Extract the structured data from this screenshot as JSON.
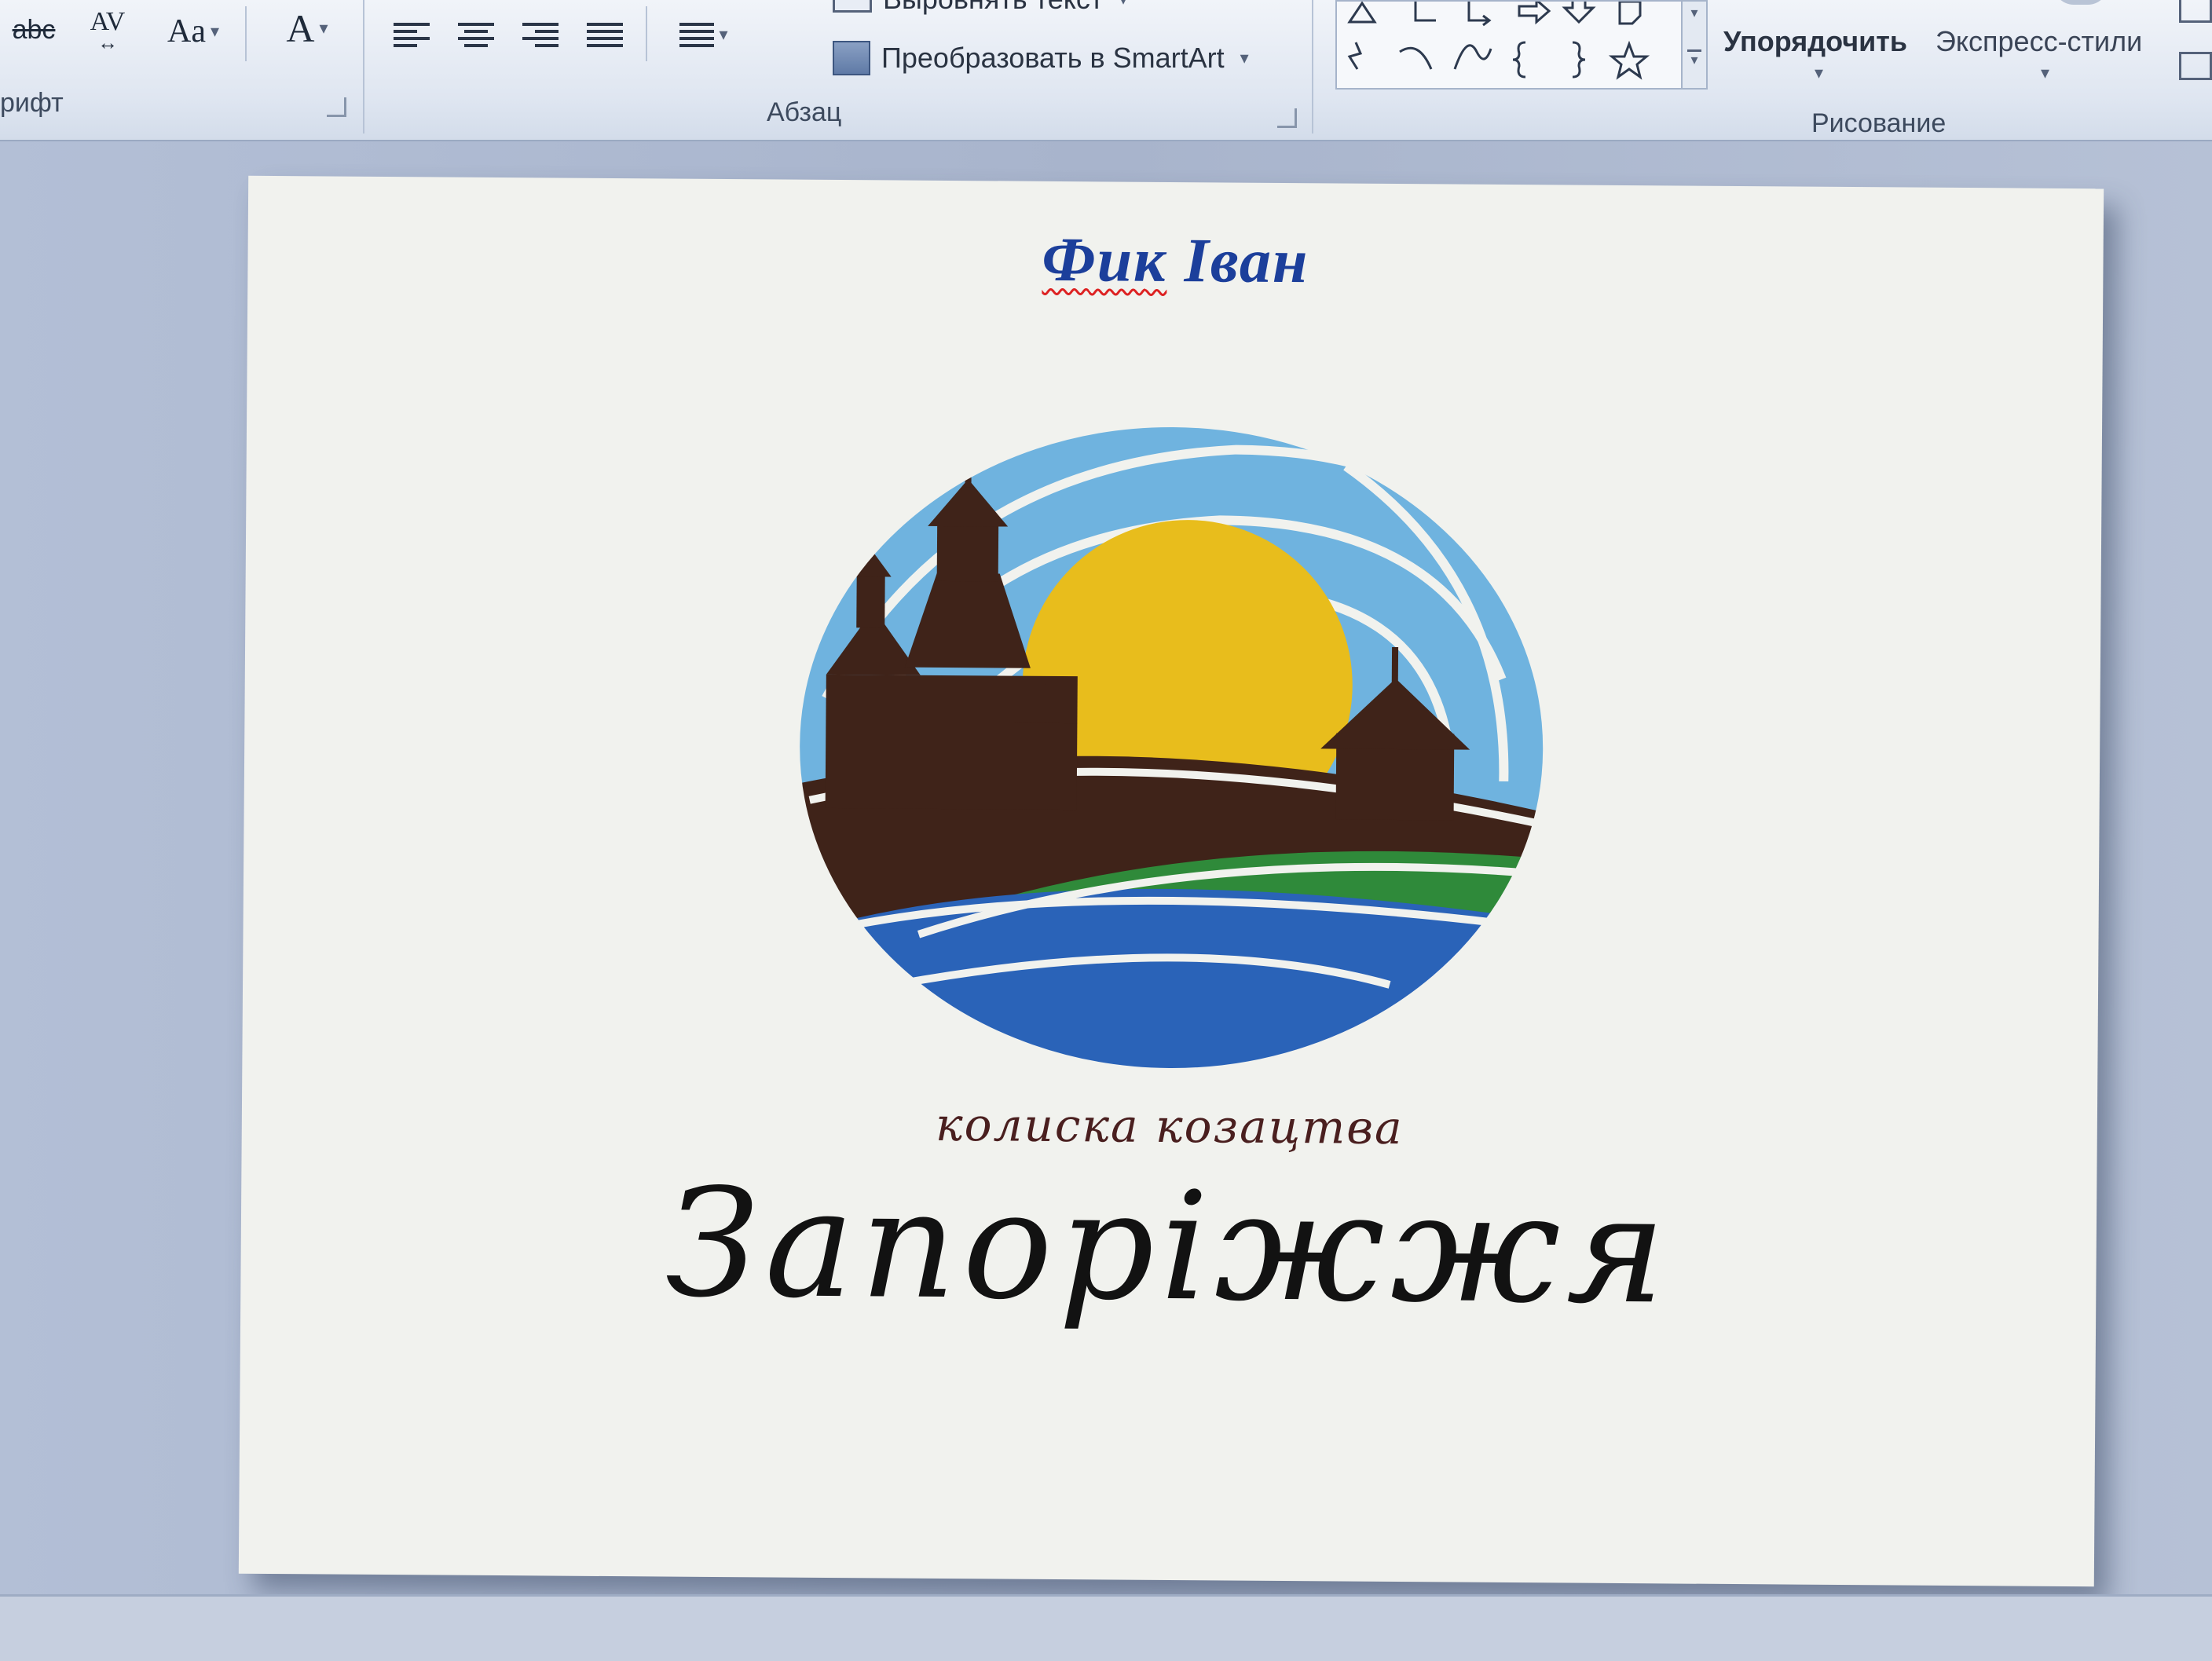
{
  "ribbon": {
    "font_group": {
      "label": "рифт",
      "strikethrough": "abc",
      "char_spacing": "AV",
      "change_case": "Aa",
      "font_color": "A"
    },
    "paragraph_group": {
      "label": "Абзац",
      "align_text": "Выровнять текст",
      "convert_smartart": "Преобразовать в SmartArt"
    },
    "drawing_group": {
      "label": "Рисование",
      "arrange": "Упорядочить",
      "quick_styles": "Экспресс-стили"
    }
  },
  "slide": {
    "author": {
      "surname": "Фик",
      "given_name": "Іван"
    },
    "logo": {
      "tagline": "колиска козацтва",
      "city": "Запоріжжя",
      "colors": {
        "sky": "#6fb3df",
        "sun": "#e8bd1c",
        "land": "#3f2319",
        "grass": "#2f8a3a",
        "water": "#2a63b8"
      }
    }
  }
}
